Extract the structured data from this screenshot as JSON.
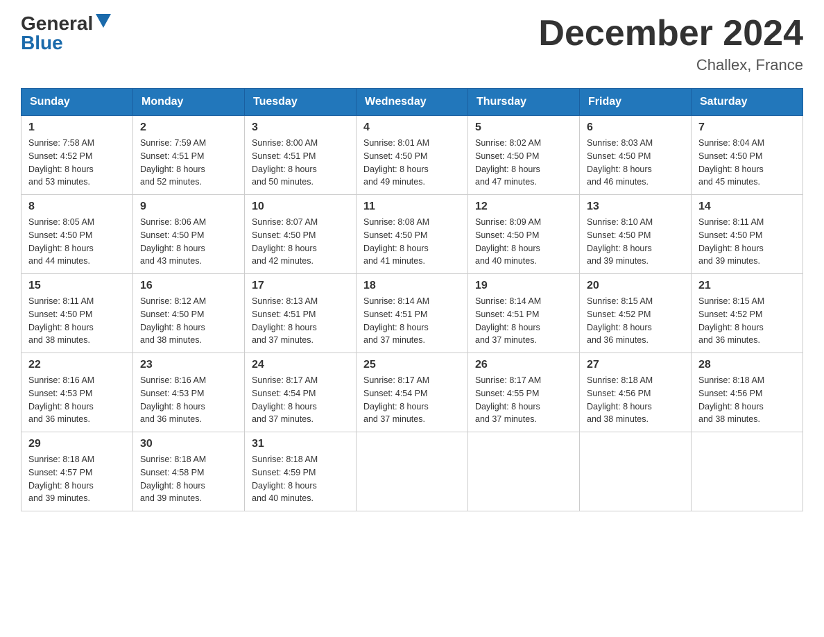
{
  "logo": {
    "general": "General",
    "blue": "Blue",
    "triangle": "▶"
  },
  "title": "December 2024",
  "subtitle": "Challex, France",
  "weekdays": [
    "Sunday",
    "Monday",
    "Tuesday",
    "Wednesday",
    "Thursday",
    "Friday",
    "Saturday"
  ],
  "weeks": [
    [
      {
        "day": "1",
        "sunrise": "7:58 AM",
        "sunset": "4:52 PM",
        "daylight": "8 hours and 53 minutes."
      },
      {
        "day": "2",
        "sunrise": "7:59 AM",
        "sunset": "4:51 PM",
        "daylight": "8 hours and 52 minutes."
      },
      {
        "day": "3",
        "sunrise": "8:00 AM",
        "sunset": "4:51 PM",
        "daylight": "8 hours and 50 minutes."
      },
      {
        "day": "4",
        "sunrise": "8:01 AM",
        "sunset": "4:50 PM",
        "daylight": "8 hours and 49 minutes."
      },
      {
        "day": "5",
        "sunrise": "8:02 AM",
        "sunset": "4:50 PM",
        "daylight": "8 hours and 47 minutes."
      },
      {
        "day": "6",
        "sunrise": "8:03 AM",
        "sunset": "4:50 PM",
        "daylight": "8 hours and 46 minutes."
      },
      {
        "day": "7",
        "sunrise": "8:04 AM",
        "sunset": "4:50 PM",
        "daylight": "8 hours and 45 minutes."
      }
    ],
    [
      {
        "day": "8",
        "sunrise": "8:05 AM",
        "sunset": "4:50 PM",
        "daylight": "8 hours and 44 minutes."
      },
      {
        "day": "9",
        "sunrise": "8:06 AM",
        "sunset": "4:50 PM",
        "daylight": "8 hours and 43 minutes."
      },
      {
        "day": "10",
        "sunrise": "8:07 AM",
        "sunset": "4:50 PM",
        "daylight": "8 hours and 42 minutes."
      },
      {
        "day": "11",
        "sunrise": "8:08 AM",
        "sunset": "4:50 PM",
        "daylight": "8 hours and 41 minutes."
      },
      {
        "day": "12",
        "sunrise": "8:09 AM",
        "sunset": "4:50 PM",
        "daylight": "8 hours and 40 minutes."
      },
      {
        "day": "13",
        "sunrise": "8:10 AM",
        "sunset": "4:50 PM",
        "daylight": "8 hours and 39 minutes."
      },
      {
        "day": "14",
        "sunrise": "8:11 AM",
        "sunset": "4:50 PM",
        "daylight": "8 hours and 39 minutes."
      }
    ],
    [
      {
        "day": "15",
        "sunrise": "8:11 AM",
        "sunset": "4:50 PM",
        "daylight": "8 hours and 38 minutes."
      },
      {
        "day": "16",
        "sunrise": "8:12 AM",
        "sunset": "4:50 PM",
        "daylight": "8 hours and 38 minutes."
      },
      {
        "day": "17",
        "sunrise": "8:13 AM",
        "sunset": "4:51 PM",
        "daylight": "8 hours and 37 minutes."
      },
      {
        "day": "18",
        "sunrise": "8:14 AM",
        "sunset": "4:51 PM",
        "daylight": "8 hours and 37 minutes."
      },
      {
        "day": "19",
        "sunrise": "8:14 AM",
        "sunset": "4:51 PM",
        "daylight": "8 hours and 37 minutes."
      },
      {
        "day": "20",
        "sunrise": "8:15 AM",
        "sunset": "4:52 PM",
        "daylight": "8 hours and 36 minutes."
      },
      {
        "day": "21",
        "sunrise": "8:15 AM",
        "sunset": "4:52 PM",
        "daylight": "8 hours and 36 minutes."
      }
    ],
    [
      {
        "day": "22",
        "sunrise": "8:16 AM",
        "sunset": "4:53 PM",
        "daylight": "8 hours and 36 minutes."
      },
      {
        "day": "23",
        "sunrise": "8:16 AM",
        "sunset": "4:53 PM",
        "daylight": "8 hours and 36 minutes."
      },
      {
        "day": "24",
        "sunrise": "8:17 AM",
        "sunset": "4:54 PM",
        "daylight": "8 hours and 37 minutes."
      },
      {
        "day": "25",
        "sunrise": "8:17 AM",
        "sunset": "4:54 PM",
        "daylight": "8 hours and 37 minutes."
      },
      {
        "day": "26",
        "sunrise": "8:17 AM",
        "sunset": "4:55 PM",
        "daylight": "8 hours and 37 minutes."
      },
      {
        "day": "27",
        "sunrise": "8:18 AM",
        "sunset": "4:56 PM",
        "daylight": "8 hours and 38 minutes."
      },
      {
        "day": "28",
        "sunrise": "8:18 AM",
        "sunset": "4:56 PM",
        "daylight": "8 hours and 38 minutes."
      }
    ],
    [
      {
        "day": "29",
        "sunrise": "8:18 AM",
        "sunset": "4:57 PM",
        "daylight": "8 hours and 39 minutes."
      },
      {
        "day": "30",
        "sunrise": "8:18 AM",
        "sunset": "4:58 PM",
        "daylight": "8 hours and 39 minutes."
      },
      {
        "day": "31",
        "sunrise": "8:18 AM",
        "sunset": "4:59 PM",
        "daylight": "8 hours and 40 minutes."
      },
      null,
      null,
      null,
      null
    ]
  ],
  "labels": {
    "sunrise": "Sunrise:",
    "sunset": "Sunset:",
    "daylight": "Daylight:"
  }
}
